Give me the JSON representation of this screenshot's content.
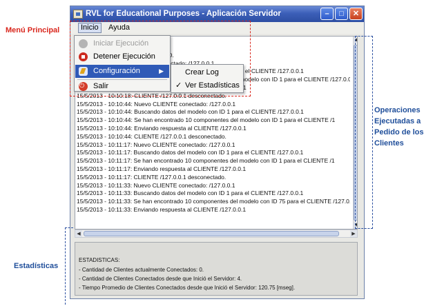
{
  "annotations": {
    "menu": "Menú Principal",
    "operations": [
      "Operaciones",
      "Ejecutadas a",
      "Pedido de los",
      "Clientes"
    ],
    "stats": "Estadísticas"
  },
  "window": {
    "title": "RVL for Educational Purposes - Aplicación Servidor",
    "min_glyph": "–",
    "max_glyph": "□",
    "close_glyph": "✕"
  },
  "menubar": {
    "inicio": "Inicio",
    "ayuda": "Ayuda"
  },
  "dropdown": {
    "iniciar": "Iniciar Ejecución",
    "detener": "Detener Ejecución",
    "configuracion": "Configuración",
    "salir": "Salir",
    "arrow": "▶"
  },
  "submenu": {
    "crear_log": "Crear Log",
    "ver_estadisticas": "Ver Estadísticas",
    "check": "✓"
  },
  "log": [
    "",
    "15/5/2013 - 10:10:18: ... ORRIENDO.",
    "15/5/2013 - 10:10:18: ... ENTE conectado: /127.0.0.1",
    "15/5/2013 - 10:10:18: Buscando datos del modelo con ID 1 para el CLIENTE /127.0.0.1",
    "15/5/2013 - 10:10:18: Se han encontrado 10 componentes del modelo con ID 1 para el CLIENTE /127.0.0.1",
    "15/5/2013 - 10:10:18: Enviando respuesta al CLIENTE /127.0.0.1",
    "15/5/2013 - 10:10:18: CLIENTE /127.0.0.1 desconectado.",
    "15/5/2013 - 10:10:44: Nuevo CLIENTE conectado: /127.0.0.1",
    "15/5/2013 - 10:10:44: Buscando datos del modelo con ID 1 para el CLIENTE /127.0.0.1",
    "15/5/2013 - 10:10:44: Se han encontrado 10 componentes del modelo con ID 1 para el CLIENTE /1",
    "15/5/2013 - 10:10:44: Enviando respuesta al CLIENTE /127.0.0.1",
    "15/5/2013 - 10:10:44: CLIENTE /127.0.0.1 desconectado.",
    "15/5/2013 - 10:11:17: Nuevo CLIENTE conectado: /127.0.0.1",
    "15/5/2013 - 10:11:17: Buscando datos del modelo con ID 1 para el CLIENTE /127.0.0.1",
    "15/5/2013 - 10:11:17: Se han encontrado 10 componentes del modelo con ID 1 para el CLIENTE /1",
    "15/5/2013 - 10:11:17: Enviando respuesta al CLIENTE /127.0.0.1",
    "15/5/2013 - 10:11:17: CLIENTE /127.0.0.1 desconectado.",
    "15/5/2013 - 10:11:33: Nuevo CLIENTE conectado: /127.0.0.1",
    "15/5/2013 - 10:11:33: Buscando datos del modelo con ID 1 para el CLIENTE /127.0.0.1",
    "15/5/2013 - 10:11:33: Se han encontrado 10 componentes del modelo con ID 75 para el CLIENTE /127.0.0.1",
    "15/5/2013 - 10:11:33: Enviando respuesta al CLIENTE /127.0.0.1"
  ],
  "scroll": {
    "up": "▲",
    "down": "▼",
    "left": "◀",
    "right": "▶"
  },
  "stats": {
    "title": "ESTADISTICAS:",
    "lines": [
      "- Cantidad de Clientes actualmente Conectados: 0.",
      "- Cantidad de Clientes Conectados desde que Inició el Servidor: 4.",
      "- Tiempo Promedio de Clientes Conectados desde que Inició el Servidor: 120.75 [mseg]."
    ]
  }
}
